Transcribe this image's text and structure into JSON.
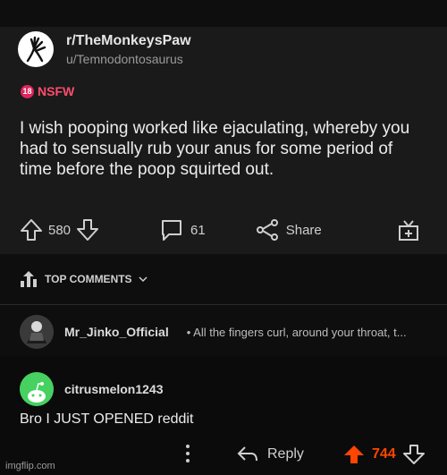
{
  "post": {
    "subreddit": "r/TheMonkeysPaw",
    "author": "u/Temnodontosaurus",
    "nsfw_label": "NSFW",
    "nsfw_badge": "18",
    "title": "I wish pooping worked like ejaculating, whereby you had to sensually rub your anus for some period of time before the poop squirted out.",
    "upvotes": "580",
    "comments": "61",
    "share_label": "Share"
  },
  "top_comments_label": "TOP COMMENTS",
  "comment1": {
    "user": "Mr_Jinko_Official",
    "preview": "• All the fingers curl, around your throat, t..."
  },
  "comment2": {
    "user": "citrusmelon1243",
    "text": "Bro I JUST OPENED reddit",
    "reply_label": "Reply",
    "score": "744"
  },
  "watermark": "imgflip.com",
  "colors": {
    "accent_orange": "#ff4500",
    "nsfw_red": "#e0245e",
    "post_bg": "#1a1a1a",
    "comment_bg": "#0b0b0b",
    "avatar_green": "#46d160"
  },
  "icons": [
    "monkey-paw-icon",
    "upvote-icon",
    "downvote-icon",
    "comment-icon",
    "share-icon",
    "award-icon",
    "top-comments-icon",
    "chevron-down-icon",
    "avatar-icon",
    "snoo-avatar-icon",
    "more-options-icon",
    "reply-icon"
  ]
}
